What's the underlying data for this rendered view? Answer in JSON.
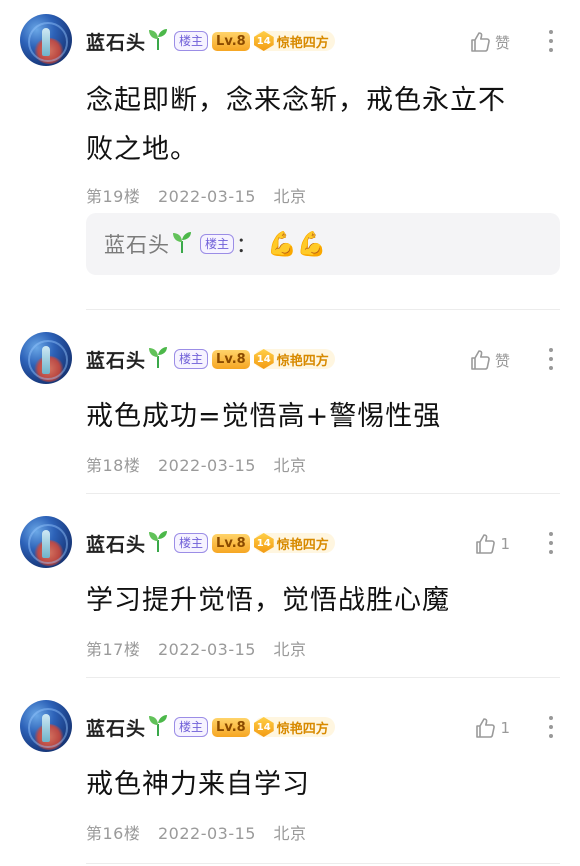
{
  "posts": [
    {
      "username": "蓝石头",
      "owner_badge": "楼主",
      "level": "Lv.8",
      "fan_level": "14",
      "fan_title": "惊艳四方",
      "like_label": "赞",
      "content_line1": "念起即断，念来念斩，戒色永立不",
      "content_line2": "败之地。",
      "floor": "第19楼",
      "date": "2022-03-15",
      "location": "北京",
      "reply": {
        "username": "蓝石头",
        "owner_badge": "楼主",
        "colon": "：",
        "emoji": "💪💪"
      }
    },
    {
      "username": "蓝石头",
      "owner_badge": "楼主",
      "level": "Lv.8",
      "fan_level": "14",
      "fan_title": "惊艳四方",
      "like_label": "赞",
      "content_line1": "戒色成功=觉悟高+警惕性强",
      "floor": "第18楼",
      "date": "2022-03-15",
      "location": "北京"
    },
    {
      "username": "蓝石头",
      "owner_badge": "楼主",
      "level": "Lv.8",
      "fan_level": "14",
      "fan_title": "惊艳四方",
      "like_label": "1",
      "content_line1": "学习提升觉悟，觉悟战胜心魔",
      "floor": "第17楼",
      "date": "2022-03-15",
      "location": "北京"
    },
    {
      "username": "蓝石头",
      "owner_badge": "楼主",
      "level": "Lv.8",
      "fan_level": "14",
      "fan_title": "惊艳四方",
      "like_label": "1",
      "content_line1": "戒色神力来自学习",
      "floor": "第16楼",
      "date": "2022-03-15",
      "location": "北京"
    }
  ],
  "icons": {
    "sprout": "sprout-icon",
    "like": "thumbs-up-icon",
    "more": "more-vertical-icon"
  },
  "colors": {
    "owner_badge": "#6f5fd8",
    "level_badge": "#f6a623",
    "fan_title": "#d88a00",
    "meta_text": "#9a9a9a"
  }
}
